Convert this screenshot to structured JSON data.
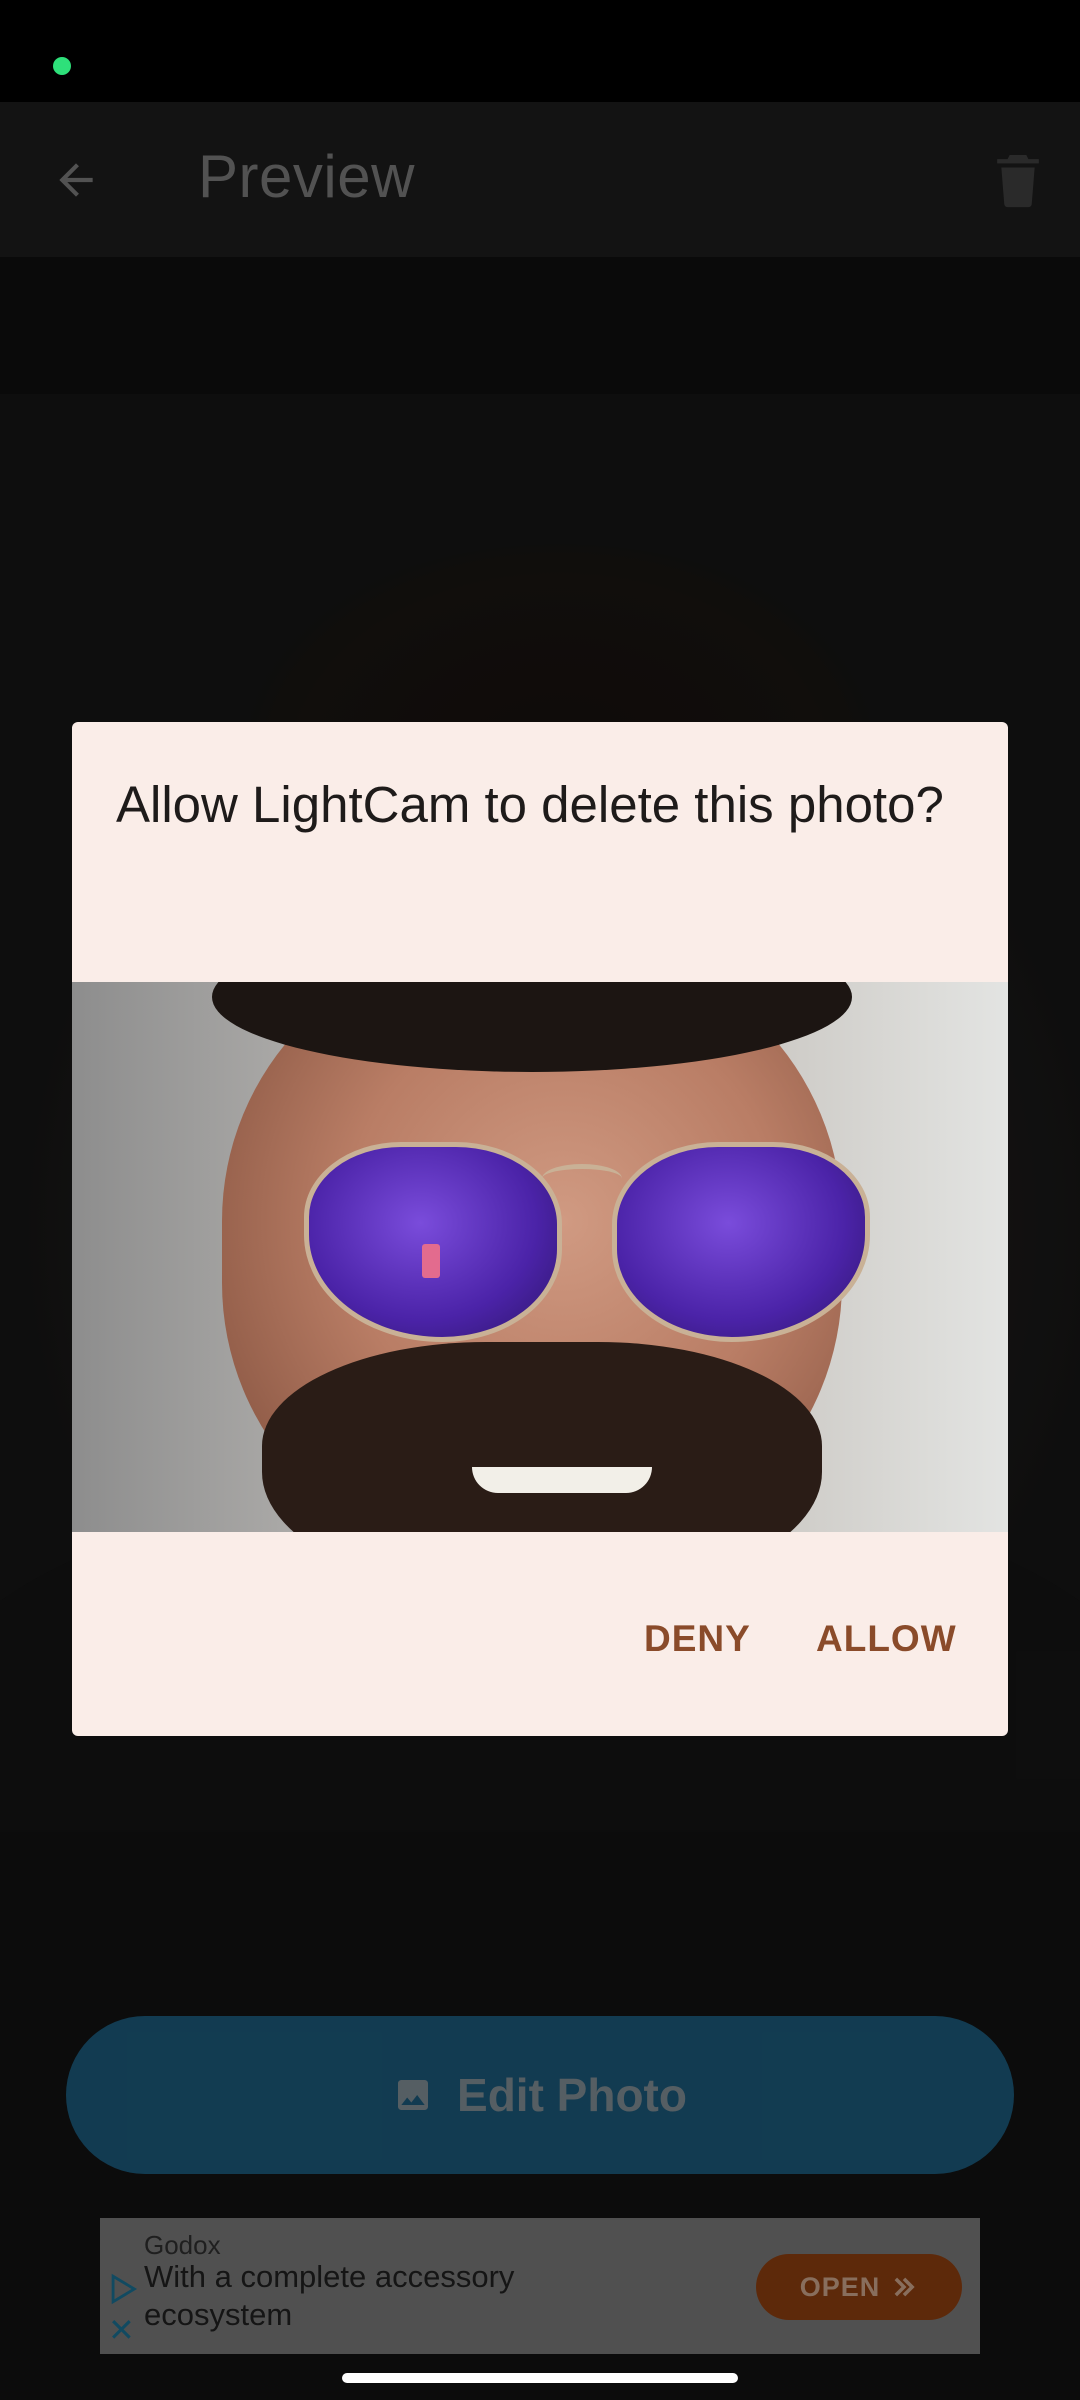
{
  "app_bar": {
    "title": "Preview",
    "back_icon": "arrow-back-icon",
    "delete_icon": "trash-icon"
  },
  "edit_button": {
    "label": "Edit Photo",
    "icon": "image-icon",
    "color": "#1b5878"
  },
  "ad": {
    "sponsor": "Godox",
    "text": "With a complete accessory ecosystem",
    "cta": "OPEN",
    "cta_color": "#8a3d10"
  },
  "dialog": {
    "title": "Allow LightCam to delete this photo?",
    "deny_label": "DENY",
    "allow_label": "ALLOW",
    "accent_color": "#8a4b2a",
    "background_color": "#faede8"
  }
}
